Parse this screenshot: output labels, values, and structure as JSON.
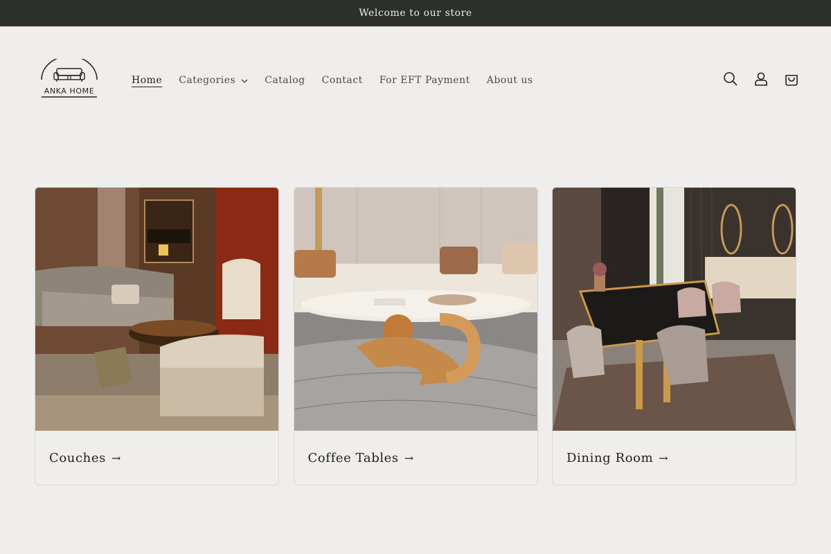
{
  "announcement": {
    "text": "Welcome to our store"
  },
  "logo": {
    "text": "ANKA HOME"
  },
  "nav": {
    "items": [
      {
        "label": "Home",
        "active": true
      },
      {
        "label": "Categories",
        "dropdown": true
      },
      {
        "label": "Catalog"
      },
      {
        "label": "Contact"
      },
      {
        "label": "For EFT Payment"
      },
      {
        "label": "About us"
      }
    ]
  },
  "header_icons": [
    "search-icon",
    "account-icon",
    "cart-icon"
  ],
  "collections": [
    {
      "title": "Couches",
      "image": "living room with tufted sofas"
    },
    {
      "title": "Coffee Tables",
      "image": "marble coffee table with gold base"
    },
    {
      "title": "Dining Room",
      "image": "glass dining table with chairs"
    }
  ],
  "colors": {
    "announcement_bg": "#2b302c",
    "page_bg": "#efeeec",
    "text": "#1f1f1f"
  }
}
